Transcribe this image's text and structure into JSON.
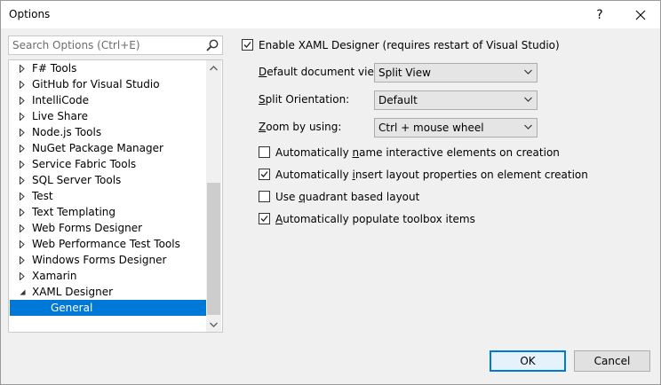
{
  "window": {
    "title": "Options",
    "help_label": "?",
    "close_label": "✕"
  },
  "search": {
    "placeholder": "Search Options (Ctrl+E)"
  },
  "tree": {
    "items": [
      {
        "label": "F# Tools",
        "expanded": false
      },
      {
        "label": "GitHub for Visual Studio",
        "expanded": false
      },
      {
        "label": "IntelliCode",
        "expanded": false
      },
      {
        "label": "Live Share",
        "expanded": false
      },
      {
        "label": "Node.js Tools",
        "expanded": false
      },
      {
        "label": "NuGet Package Manager",
        "expanded": false
      },
      {
        "label": "Service Fabric Tools",
        "expanded": false
      },
      {
        "label": "SQL Server Tools",
        "expanded": false
      },
      {
        "label": "Test",
        "expanded": false
      },
      {
        "label": "Text Templating",
        "expanded": false
      },
      {
        "label": "Web Forms Designer",
        "expanded": false
      },
      {
        "label": "Web Performance Test Tools",
        "expanded": false
      },
      {
        "label": "Windows Forms Designer",
        "expanded": false
      },
      {
        "label": "Xamarin",
        "expanded": false
      },
      {
        "label": "XAML Designer",
        "expanded": true
      }
    ],
    "selected_child": "General"
  },
  "settings": {
    "enable": {
      "label": "Enable XAML Designer (requires restart of Visual Studio)",
      "checked": true
    },
    "default_view": {
      "label_pre": "",
      "label_u": "D",
      "label_post": "efault document view:",
      "value": "Split View"
    },
    "split_orientation": {
      "label_pre": "",
      "label_u": "S",
      "label_post": "plit Orientation:",
      "value": "Default"
    },
    "zoom": {
      "label_pre": "",
      "label_u": "Z",
      "label_post": "oom by using:",
      "value": "Ctrl + mouse wheel"
    },
    "auto_name": {
      "label_pre": "Automatically ",
      "label_u": "n",
      "label_post": "ame interactive elements on creation",
      "checked": false
    },
    "auto_layout": {
      "label_pre": "Automatically ",
      "label_u": "i",
      "label_post": "nsert layout properties on element creation",
      "checked": true
    },
    "quadrant": {
      "label_pre": "Use ",
      "label_u": "q",
      "label_post": "uadrant based layout",
      "checked": false
    },
    "toolbox": {
      "label_pre": "",
      "label_u": "A",
      "label_post": "utomatically populate toolbox items",
      "checked": true
    }
  },
  "buttons": {
    "ok": "OK",
    "cancel": "Cancel"
  }
}
